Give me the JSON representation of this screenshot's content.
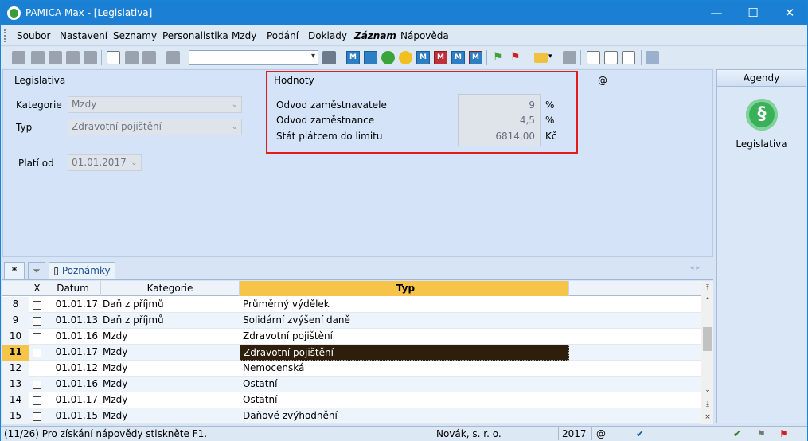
{
  "window": {
    "title": "PAMICA Max - [Legislativa]",
    "min": "—",
    "max": "☐",
    "close": "✕"
  },
  "menu": [
    "Soubor",
    "Nastavení",
    "Seznamy",
    "Personalistika",
    "Mzdy",
    "Podání",
    "Doklady",
    "Záznam",
    "Nápověda"
  ],
  "form": {
    "section_title": "Legislativa",
    "kategorie_label": "Kategorie",
    "kategorie_value": "Mzdy",
    "typ_label": "Typ",
    "typ_value": "Zdravotní pojištění",
    "plati_od_label": "Platí od",
    "plati_od_value": "01.01.2017",
    "at_symbol": "@"
  },
  "hodnoty": {
    "title": "Hodnoty",
    "rows": [
      {
        "label": "Odvod zaměstnavatele",
        "value": "9",
        "unit": "%"
      },
      {
        "label": "Odvod zaměstnance",
        "value": "4,5",
        "unit": "%"
      },
      {
        "label": "Stát plátcem do limitu",
        "value": "6814,00",
        "unit": "Kč"
      }
    ]
  },
  "agenda": {
    "header": "Agendy",
    "icon_char": "§",
    "item_label": "Legislativa"
  },
  "tabs": {
    "star": "*",
    "notes": "Poznámky"
  },
  "grid": {
    "headers": {
      "x": "X",
      "datum": "Datum",
      "kategorie": "Kategorie",
      "typ": "Typ"
    },
    "rows": [
      {
        "n": "8",
        "datum": "01.01.17",
        "kategorie": "Daň z příjmů",
        "typ": "Průměrný výdělek"
      },
      {
        "n": "9",
        "datum": "01.01.13",
        "kategorie": "Daň z příjmů",
        "typ": "Solidární zvýšení daně"
      },
      {
        "n": "10",
        "datum": "01.01.16",
        "kategorie": "Mzdy",
        "typ": "Zdravotní pojištění"
      },
      {
        "n": "11",
        "datum": "01.01.17",
        "kategorie": "Mzdy",
        "typ": "Zdravotní pojištění"
      },
      {
        "n": "12",
        "datum": "01.01.12",
        "kategorie": "Mzdy",
        "typ": "Nemocenská"
      },
      {
        "n": "13",
        "datum": "01.01.16",
        "kategorie": "Mzdy",
        "typ": "Ostatní"
      },
      {
        "n": "14",
        "datum": "01.01.17",
        "kategorie": "Mzdy",
        "typ": "Ostatní"
      },
      {
        "n": "15",
        "datum": "01.01.15",
        "kategorie": "Mzdy",
        "typ": "Daňové zvýhodnění"
      }
    ],
    "current_index": 3
  },
  "status": {
    "hint": "(11/26) Pro získání nápovědy stiskněte F1.",
    "company": "Novák, s. r. o.",
    "year": "2017",
    "at": "@"
  },
  "colors": {
    "titlebar": "#1b7fd4",
    "highlight_frame": "#e31b1b",
    "selected_row": "#2d1f0c",
    "header_active": "#f7c44a"
  }
}
